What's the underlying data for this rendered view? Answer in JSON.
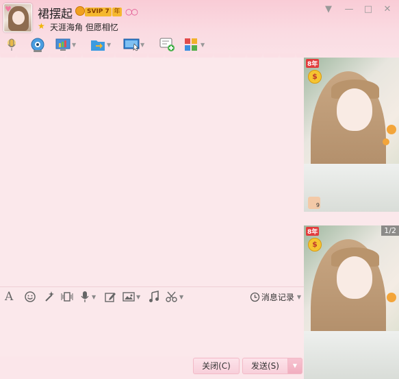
{
  "profile": {
    "nickname": "裙摆起",
    "vip_label": "SVIP 7",
    "year_label": "年",
    "signature": "天涯海角 但愿相忆"
  },
  "window": {
    "minimize": "▼",
    "restore": "—",
    "maximize": "□",
    "close": "✕"
  },
  "input_toolbar": {
    "history_label": "消息记录"
  },
  "buttons": {
    "close": "关闭(C)",
    "send": "发送(S)"
  },
  "side_panel": {
    "year_tag": "8年",
    "gold_glyph": "$",
    "level": "9",
    "page_indicator": "1/2"
  },
  "colors": {
    "header_pink": "#f9ccd6",
    "chat_bg": "#fbe8eb",
    "button_border": "#f2b9c6",
    "vip_gold": "#f5b82e"
  },
  "icons": [
    "mic-icon",
    "webcam-icon",
    "screen-share-icon",
    "file-transfer-icon",
    "remote-desktop-icon",
    "group-chat-icon",
    "apps-icon",
    "font-icon",
    "emoji-icon",
    "magic-icon",
    "shake-icon",
    "voice-message-icon",
    "edit-icon",
    "image-icon",
    "music-icon",
    "screenshot-icon",
    "clock-icon"
  ]
}
